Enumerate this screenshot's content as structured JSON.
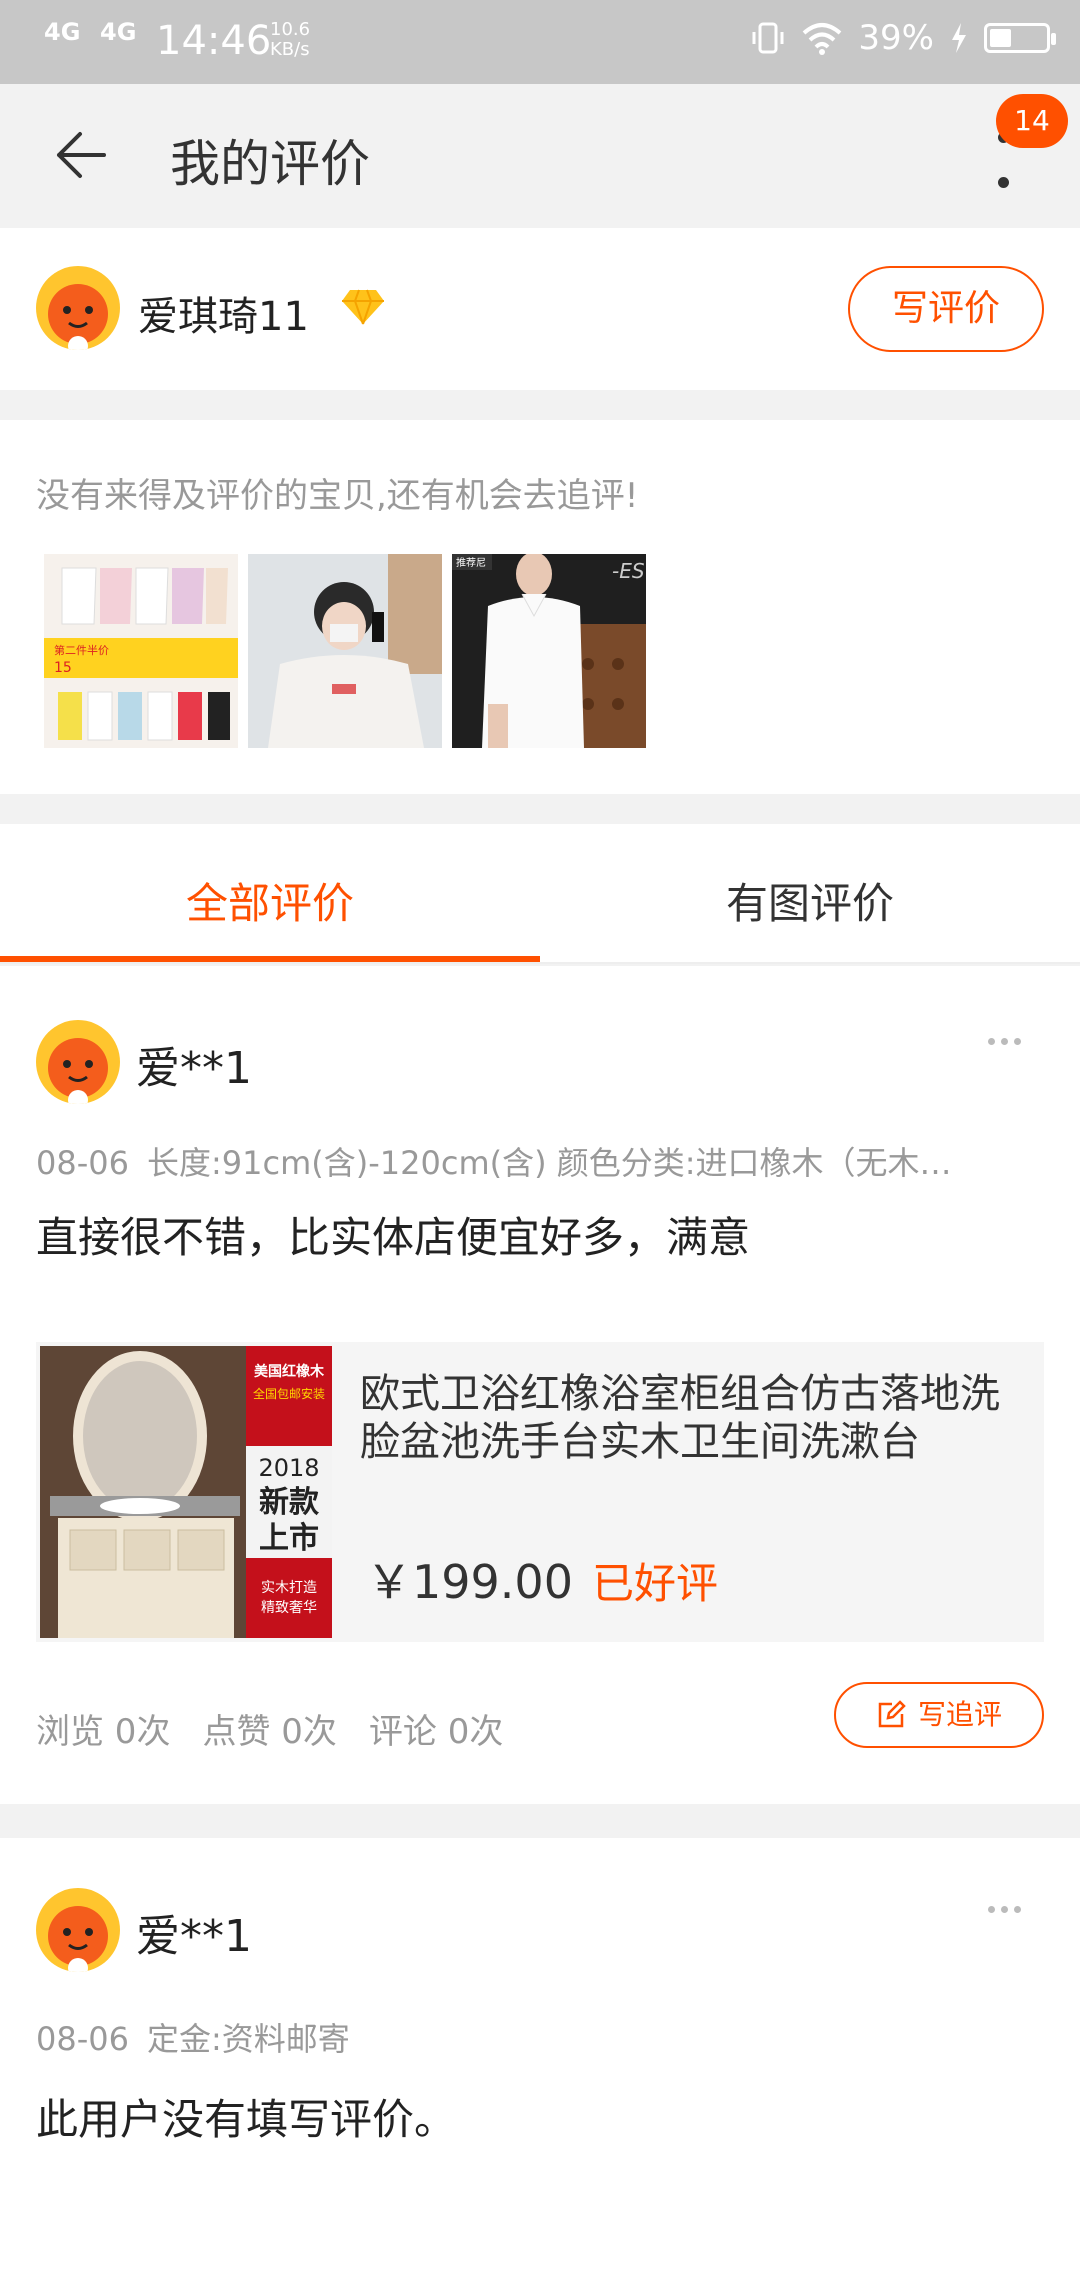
{
  "status_bar": {
    "signal_1": "4G",
    "signal_2": "4G",
    "time": "14:46",
    "speed_value": "10.6",
    "speed_unit": "KB/s",
    "battery": "39%",
    "battery_level": 0.39
  },
  "nav": {
    "title": "我的评价",
    "badge": "14"
  },
  "user": {
    "name": "爱琪琦11",
    "write_label": "写评价"
  },
  "pending": {
    "hint": "没有来得及评价的宝贝,还有机会去追评!",
    "thumb_text": [
      "第二件半价",
      "15",
      "推荐尼",
      "-ES"
    ]
  },
  "tabs": [
    {
      "label": "全部评价"
    },
    {
      "label": "有图评价"
    }
  ],
  "reviews": [
    {
      "name": "爱**1",
      "date": "08-06",
      "spec": "长度:91cm(含)-120cm(含) 颜色分类:进口橡木（无木…",
      "content": "直接很不错，比实体店便宜好多，满意",
      "product": {
        "title": "欧式卫浴红橡浴室柜组合仿古落地洗脸盆池洗手台实木卫生间洗漱台",
        "price": "￥199.00",
        "status": "已好评",
        "image_text": {
          "banner": "美国红橡木",
          "banner2": "全国包邮安装",
          "year": "2018",
          "line1": "新款",
          "line2": "上市",
          "foot1": "实木打造",
          "foot2": "精致奢华"
        }
      },
      "stats": [
        "浏览 0次",
        "点赞 0次",
        "评论 0次"
      ],
      "followup_label": "写追评"
    },
    {
      "name": "爱**1",
      "date": "08-06",
      "spec": "定金:资料邮寄",
      "content": "此用户没有填写评价。"
    }
  ],
  "colors": {
    "accent": "#ff5000",
    "status_bar": "#c7c7c7",
    "background": "#f2f2f2"
  }
}
